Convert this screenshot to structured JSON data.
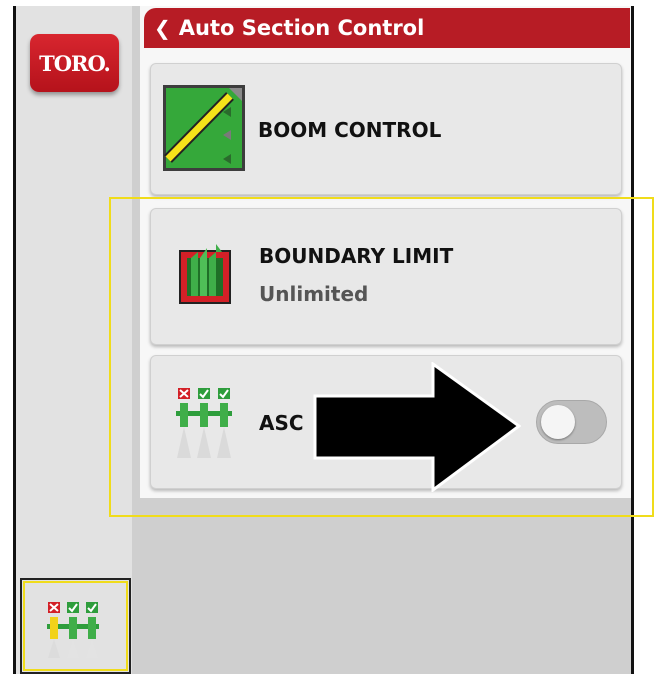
{
  "brand": {
    "logo_text": "TORO."
  },
  "header": {
    "back_icon": "chevron-left-icon",
    "title": "Auto Section Control"
  },
  "cards": {
    "boom_control": {
      "icon": "boom-control-icon",
      "title": "BOOM CONTROL"
    },
    "boundary_limit": {
      "icon": "boundary-limit-icon",
      "title": "BOUNDARY LIMIT",
      "value": "Unlimited"
    },
    "asc": {
      "icon": "asc-sections-icon",
      "title": "ASC",
      "toggle_on": false
    }
  },
  "sidebar": {
    "asc_icon": "asc-sections-icon"
  },
  "annotations": {
    "arrow_icon": "right-arrow-icon",
    "highlight_color": "#f0dc1a"
  },
  "colors": {
    "header": "#b71c25",
    "accent_green": "#35a83a",
    "toggle_off": "#bdbdbd"
  }
}
